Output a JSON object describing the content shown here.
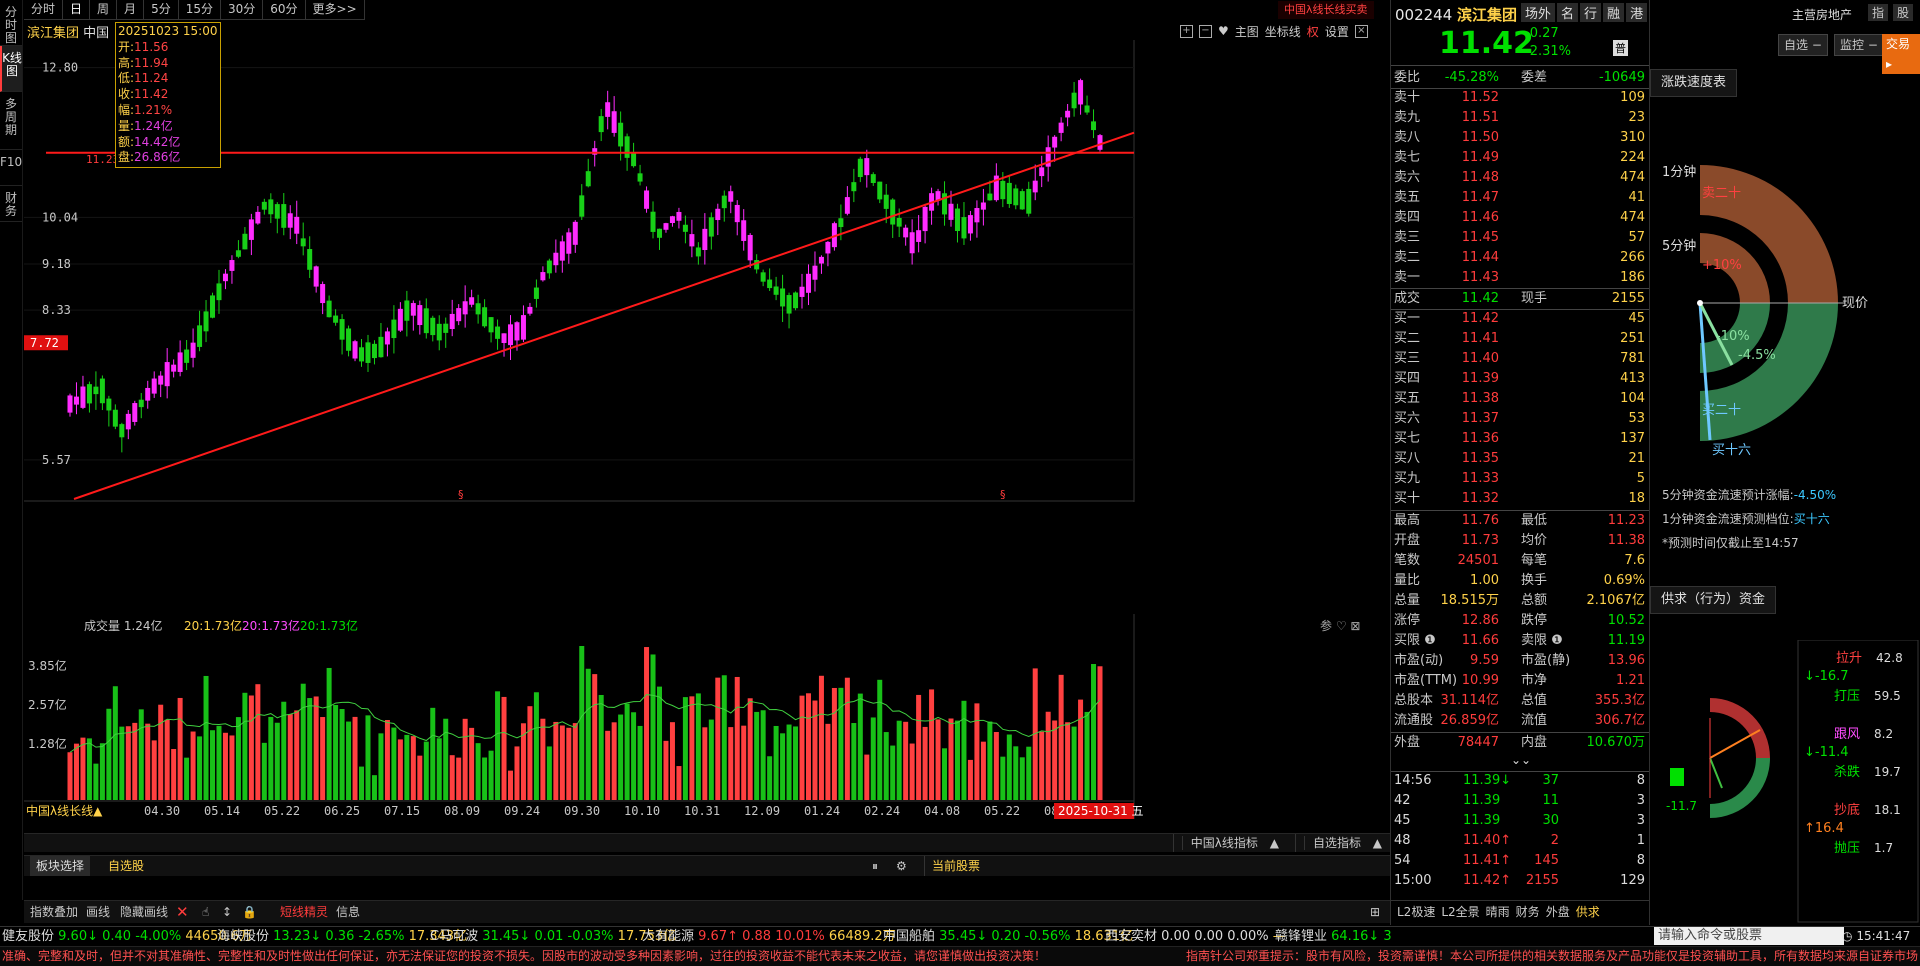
{
  "vtabs": [
    "分时图",
    "K线图",
    "多周期",
    "F10",
    "财务"
  ],
  "periods": [
    "分时",
    "日",
    "周",
    "月",
    "5分",
    "15分",
    "30分",
    "60分",
    "更多>>"
  ],
  "active_period": "日",
  "promo": "中国λ线长线买卖",
  "stock_title": "滨江集团",
  "stock_title_extra": "中国",
  "tools": {
    "zoom_in": "+",
    "zoom_out": "−",
    "main": "主图",
    "coord": "坐标线",
    "quan": "权",
    "settings": "设置"
  },
  "tooltip": {
    "date": "20251023 15:00",
    "rows": [
      {
        "l": "开:",
        "v": "11.56"
      },
      {
        "l": "高:",
        "v": "11.94"
      },
      {
        "l": "低:",
        "v": "11.24"
      },
      {
        "l": "收:",
        "v": "11.42"
      },
      {
        "l": "幅:",
        "v": "1.21%"
      },
      {
        "l": "量:",
        "v": "1.24亿"
      },
      {
        "l": "额:",
        "v": "14.42亿"
      },
      {
        "l": "盘:",
        "v": "26.86亿"
      }
    ]
  },
  "chart_data": {
    "type": "candlestick",
    "price_axis_labels": [
      "12.80",
      "10.04",
      "9.18",
      "8.33",
      "5.57"
    ],
    "hline_label": "11.23",
    "current_label": "7.72",
    "x_labels": [
      "04.30",
      "05.14",
      "05.22",
      "06.25",
      "07.15",
      "08.09",
      "09.24",
      "09.30",
      "10.10",
      "10.31",
      "12.09",
      "01.24",
      "02.24",
      "04.08",
      "05.22",
      "08.25"
    ],
    "last_date": "2025-10-31 五",
    "volume_title": "成交量 1.24亿",
    "volume_ma": [
      "20:1.73亿",
      "20:1.73亿",
      "20:1.73亿"
    ],
    "volume_axis": [
      "3.85亿",
      "2.57亿",
      "1.28亿"
    ],
    "indicator_name": "中国λ线长线"
  },
  "indicator_bar": {
    "a": "中国λ线指标",
    "b": "自选指标"
  },
  "block_bar": {
    "a": "板块选择",
    "b": "自选股",
    "c": "当前股票"
  },
  "tool_bar": {
    "a": "指数叠加",
    "b": "画线",
    "c": "隐藏画线",
    "d": "短线精灵",
    "e": "信息"
  },
  "quote": {
    "code": "002244",
    "name": "滨江集团",
    "tabs": [
      "场外",
      "名",
      "行",
      "融",
      "港"
    ],
    "price": "11.42",
    "change": "-0.27",
    "pct": "-2.31%",
    "pu": "普",
    "sector": "主营房地产",
    "zhi": "指",
    "gu": "股",
    "btn_zixuan": "自选",
    "btn_jiankong": "监控",
    "btn_trade": "交易",
    "weibi_l": "委比",
    "weibi": "-45.28%",
    "weicha_l": "委差",
    "weicha": "-10649",
    "sells": [
      [
        "卖十",
        "11.52",
        "109"
      ],
      [
        "卖九",
        "11.51",
        "23"
      ],
      [
        "卖八",
        "11.50",
        "310"
      ],
      [
        "卖七",
        "11.49",
        "224"
      ],
      [
        "卖六",
        "11.48",
        "474"
      ],
      [
        "卖五",
        "11.47",
        "41"
      ],
      [
        "卖四",
        "11.46",
        "474"
      ],
      [
        "卖三",
        "11.45",
        "57"
      ],
      [
        "卖二",
        "11.44",
        "266"
      ],
      [
        "卖一",
        "11.43",
        "186"
      ]
    ],
    "deal": [
      "成交",
      "11.42",
      "现手",
      "2155"
    ],
    "buys": [
      [
        "买一",
        "11.42",
        "45"
      ],
      [
        "买二",
        "11.41",
        "251"
      ],
      [
        "买三",
        "11.40",
        "781"
      ],
      [
        "买四",
        "11.39",
        "413"
      ],
      [
        "买五",
        "11.38",
        "104"
      ],
      [
        "买六",
        "11.37",
        "53"
      ],
      [
        "买七",
        "11.36",
        "137"
      ],
      [
        "买八",
        "11.35",
        "21"
      ],
      [
        "买九",
        "11.33",
        "5"
      ],
      [
        "买十",
        "11.32",
        "18"
      ]
    ],
    "stats": [
      [
        "最高",
        "11.76",
        "最低",
        "11.23"
      ],
      [
        "开盘",
        "11.73",
        "均价",
        "11.38"
      ],
      [
        "笔数",
        "24501",
        "每笔",
        "7.6"
      ],
      [
        "量比",
        "1.00",
        "换手",
        "0.69%"
      ],
      [
        "总量",
        "18.515万",
        "总额",
        "2.1067亿"
      ],
      [
        "涨停",
        "12.86",
        "跌停",
        "10.52"
      ],
      [
        "买限 ❶",
        "11.66",
        "卖限 ❶",
        "11.19"
      ],
      [
        "市盈(动)",
        "9.59",
        "市盈(静)",
        "13.96"
      ],
      [
        "市盈(TTM)",
        "10.99",
        "市净",
        "1.21"
      ],
      [
        "总股本",
        "31.114亿",
        "总值",
        "355.3亿"
      ],
      [
        "流通股",
        "26.859亿",
        "流值",
        "306.7亿"
      ]
    ],
    "waipan": [
      "外盘",
      "78447",
      "内盘",
      "10.670万"
    ],
    "ticks": [
      [
        "14:56",
        "11.39↓",
        "37",
        "8"
      ],
      [
        "42",
        "11.39",
        "11",
        "3"
      ],
      [
        "45",
        "11.39",
        "30",
        "3"
      ],
      [
        "48",
        "11.40↑",
        "2",
        "1"
      ],
      [
        "54",
        "11.41↑",
        "145",
        "8"
      ],
      [
        "15:00",
        "11.42↑",
        "2155",
        "129"
      ]
    ],
    "bottom_tabs": [
      "L2极速",
      "L2全景",
      "晴雨",
      "财务",
      "外盘",
      "供求"
    ]
  },
  "speed": {
    "title": "涨跌速度表",
    "l1": "1分钟",
    "l5": "5分钟",
    "sell2": "卖二十",
    "p10": "+10%",
    "now": "现价",
    "m10": "-10%",
    "m45": "-4.5%",
    "buy20": "买二十",
    "buy16": "买十六",
    "t1": "5分钟资金流速预计涨幅:",
    "v1": "-4.50%",
    "t2": "1分钟资金流速预测档位:",
    "v2": "买十六",
    "t3": "*预测时间仅截止至14:57"
  },
  "supply": {
    "title": "供求（行为）资金",
    "arrow_v": "-11.7",
    "items": [
      [
        "拉升",
        "42.8"
      ],
      [
        "↓-16.7",
        ""
      ],
      [
        "打压",
        "59.5"
      ],
      [
        "跟风",
        "8.2"
      ],
      [
        "↓-11.4",
        ""
      ],
      [
        "杀跌",
        "19.7"
      ],
      [
        "抄底",
        "18.1"
      ],
      [
        "↑16.4",
        ""
      ],
      [
        "抛压",
        "1.7"
      ]
    ]
  },
  "ticker": [
    [
      "健友股份",
      "9.60↓",
      "0.40",
      "-4.00%",
      "44650.6万"
    ],
    [
      "海峡股份",
      "13.23↓",
      "0.36",
      "-2.65%",
      "17.343亿"
    ],
    [
      "C马可波",
      "31.45↓",
      "0.01",
      "-0.03%",
      "17.753亿"
    ],
    [
      "大有能源",
      "9.67↑",
      "0.88",
      "10.01%",
      "66489.2万"
    ],
    [
      "中国船舶",
      "35.45↓",
      "0.20",
      "-0.56%",
      "18.631亿"
    ],
    [
      "西安奕材",
      "0.00",
      "0.00",
      "0.00%",
      "—"
    ],
    [
      "赣锋锂业",
      "64.16↓",
      "3",
      ""
    ]
  ],
  "cmd_placeholder": "请输入命令或股票",
  "clock": "15:41:47",
  "status_left": "准确、完整和及时，但并不对其准确性、完整性和及时性做出任何保证，亦无法保证您的投资不损失。因股市的波动受多种因素影响，过往的投资收益不能代表未来之收益，请您谨慎做出投资决策！",
  "status_right": "指南针公司郑重提示：股市有风险，投资需谨慎！本公司所提供的相关数据服务及产品功能仅是投资辅助工具，所有数据均来源自证券市场"
}
